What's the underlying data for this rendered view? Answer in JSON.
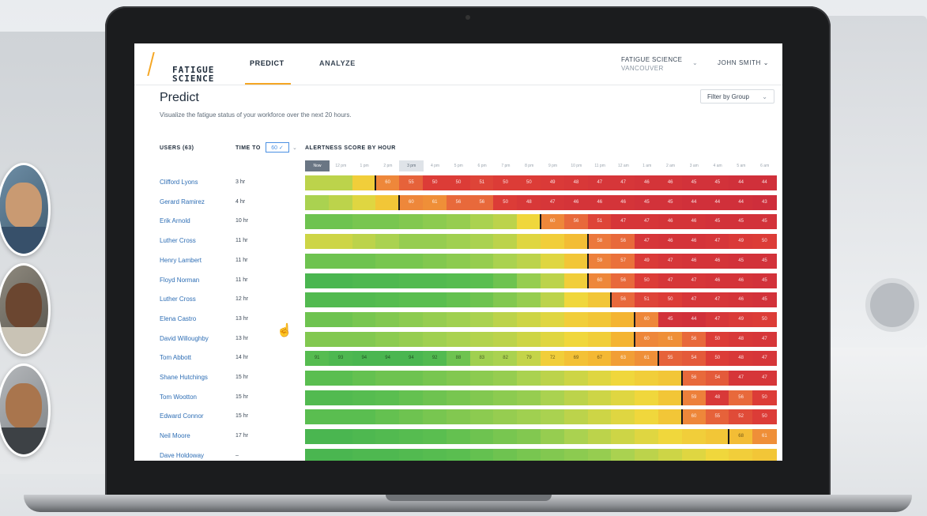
{
  "app": {
    "logo_line1": "FATIGUE",
    "logo_line2": "SCIENCE",
    "nav": {
      "predict": "PREDICT",
      "analyze": "ANALYZE"
    },
    "org": {
      "name": "FATIGUE SCIENCE",
      "city": "VANCOUVER",
      "chevron": "⌄"
    },
    "user": "JOHN SMITH ⌄",
    "accent": "#f5a623",
    "link_color": "#2e6eb5"
  },
  "page": {
    "title": "Predict",
    "subtitle": "Visualize the fatigue status of your workforce over the next 20 hours.",
    "filter_label": "Filter by Group",
    "filter_chevron": "⌄"
  },
  "table": {
    "users_header": "USERS (63)",
    "timeto_header": "TIME TO",
    "timeto_value": "60 ✓",
    "timeto_chevron": "⌄",
    "alertness_header": "ALERTNESS SCORE BY HOUR",
    "hours": [
      "Now",
      "12 pm",
      "1 pm",
      "2 pm",
      "3 pm",
      "4 pm",
      "5 pm",
      "6 pm",
      "7 pm",
      "8 pm",
      "9 pm",
      "10 pm",
      "11 pm",
      "12 am",
      "1 am",
      "2 am",
      "3 am",
      "4 am",
      "5 am",
      "6 am"
    ],
    "selected_hour_index": 4,
    "rows": [
      {
        "name": "Clifford Lyons",
        "time_to": "3 hr",
        "marker_index": 3,
        "scores": [
          80,
          80,
          72,
          60,
          55,
          50,
          50,
          51,
          50,
          50,
          49,
          48,
          47,
          47,
          46,
          46,
          45,
          45,
          44,
          44
        ],
        "labels": [
          "",
          "",
          "",
          "60",
          "55",
          "50",
          "50",
          "51",
          "50",
          "50",
          "49",
          "48",
          "47",
          "47",
          "46",
          "46",
          "45",
          "45",
          "44",
          "44"
        ]
      },
      {
        "name": "Gerard Ramirez",
        "time_to": "4 hr",
        "marker_index": 4,
        "scores": [
          82,
          80,
          76,
          70,
          60,
          61,
          56,
          56,
          50,
          48,
          47,
          46,
          46,
          46,
          45,
          45,
          44,
          44,
          44,
          43
        ],
        "labels": [
          "",
          "",
          "",
          "",
          "60",
          "61",
          "56",
          "56",
          "50",
          "48",
          "47",
          "46",
          "46",
          "46",
          "45",
          "45",
          "44",
          "44",
          "44",
          "43"
        ]
      },
      {
        "name": "Erik Arnold",
        "time_to": "10 hr",
        "marker_index": 10,
        "scores": [
          88,
          88,
          87,
          87,
          86,
          85,
          84,
          82,
          80,
          74,
          60,
          56,
          51,
          47,
          47,
          46,
          46,
          45,
          45,
          45
        ],
        "labels": [
          "",
          "",
          "",
          "",
          "",
          "",
          "",
          "",
          "",
          "",
          "60",
          "56",
          "51",
          "47",
          "47",
          "46",
          "46",
          "45",
          "45",
          "45"
        ]
      },
      {
        "name": "Luther Cross",
        "time_to": "11 hr",
        "marker_index": 12,
        "scores": [
          78,
          78,
          80,
          82,
          84,
          84,
          83,
          82,
          80,
          76,
          72,
          68,
          58,
          56,
          47,
          46,
          46,
          47,
          49,
          50
        ],
        "labels": [
          "",
          "",
          "",
          "",
          "",
          "",
          "",
          "",
          "",
          "",
          "",
          "",
          "58",
          "56",
          "47",
          "46",
          "46",
          "47",
          "49",
          "50"
        ]
      },
      {
        "name": "Henry Lambert",
        "time_to": "11 hr",
        "marker_index": 12,
        "scores": [
          88,
          88,
          88,
          87,
          87,
          86,
          85,
          84,
          82,
          80,
          76,
          70,
          59,
          57,
          49,
          47,
          46,
          46,
          45,
          45
        ],
        "labels": [
          "",
          "",
          "",
          "",
          "",
          "",
          "",
          "",
          "",
          "",
          "",
          "",
          "59",
          "57",
          "49",
          "47",
          "46",
          "46",
          "45",
          "45"
        ]
      },
      {
        "name": "Floyd Norman",
        "time_to": "11 hr",
        "marker_index": 12,
        "scores": [
          94,
          94,
          93,
          93,
          92,
          92,
          91,
          90,
          88,
          84,
          80,
          72,
          60,
          56,
          50,
          47,
          47,
          46,
          46,
          45
        ],
        "labels": [
          "",
          "",
          "",
          "",
          "",
          "",
          "",
          "",
          "",
          "",
          "",
          "",
          "60",
          "56",
          "50",
          "47",
          "47",
          "46",
          "46",
          "45"
        ]
      },
      {
        "name": "Luther Cross",
        "time_to": "12 hr",
        "marker_index": 13,
        "scores": [
          92,
          92,
          92,
          91,
          90,
          90,
          89,
          88,
          86,
          84,
          80,
          74,
          70,
          56,
          51,
          50,
          47,
          47,
          46,
          45
        ],
        "labels": [
          "",
          "",
          "",
          "",
          "",
          "",
          "",
          "",
          "",
          "",
          "",
          "",
          "",
          "56",
          "51",
          "50",
          "47",
          "47",
          "46",
          "45"
        ]
      },
      {
        "name": "Elena Castro",
        "time_to": "13 hr",
        "marker_index": 14,
        "scores": [
          88,
          88,
          87,
          86,
          85,
          84,
          83,
          82,
          80,
          78,
          76,
          72,
          70,
          66,
          60,
          45,
          44,
          47,
          49,
          50
        ],
        "labels": [
          "",
          "",
          "",
          "",
          "",
          "",
          "",
          "",
          "",
          "",
          "",
          "",
          "",
          "",
          "60",
          "45",
          "44",
          "47",
          "49",
          "50"
        ]
      },
      {
        "name": "David Willoughby",
        "time_to": "13 hr",
        "marker_index": 14,
        "scores": [
          86,
          86,
          86,
          85,
          84,
          83,
          82,
          81,
          80,
          78,
          76,
          74,
          72,
          66,
          60,
          61,
          56,
          50,
          48,
          47
        ],
        "labels": [
          "",
          "",
          "",
          "",
          "",
          "",
          "",
          "",
          "",
          "",
          "",
          "",
          "",
          "",
          "60",
          "61",
          "56",
          "50",
          "48",
          "47"
        ]
      },
      {
        "name": "Tom Abbott",
        "time_to": "14 hr",
        "marker_index": 15,
        "scores": [
          91,
          93,
          94,
          94,
          94,
          92,
          88,
          83,
          82,
          79,
          72,
          69,
          67,
          63,
          61,
          55,
          54,
          50,
          48,
          47
        ],
        "labels": [
          "91",
          "93",
          "94",
          "94",
          "94",
          "92",
          "88",
          "83",
          "82",
          "79",
          "72",
          "69",
          "67",
          "63",
          "61",
          "55",
          "54",
          "50",
          "48",
          "47"
        ]
      },
      {
        "name": "Shane Hutchings",
        "time_to": "15 hr",
        "marker_index": 16,
        "scores": [
          90,
          90,
          89,
          88,
          88,
          87,
          86,
          85,
          84,
          82,
          80,
          78,
          76,
          74,
          72,
          70,
          56,
          54,
          47,
          47
        ],
        "labels": [
          "",
          "",
          "",
          "",
          "",
          "",
          "",
          "",
          "",
          "",
          "",
          "",
          "",
          "",
          "",
          "",
          "56",
          "54",
          "47",
          "47"
        ]
      },
      {
        "name": "Tom Wootton",
        "time_to": "15 hr",
        "marker_index": 16,
        "scores": [
          92,
          92,
          91,
          90,
          89,
          88,
          87,
          86,
          85,
          84,
          82,
          80,
          78,
          76,
          74,
          70,
          59,
          48,
          56,
          50
        ],
        "labels": [
          "",
          "",
          "",
          "",
          "",
          "",
          "",
          "",
          "",
          "",
          "",
          "",
          "",
          "",
          "",
          "",
          "59",
          "48",
          "56",
          "50"
        ]
      },
      {
        "name": "Edward Connor",
        "time_to": "15 hr",
        "marker_index": 16,
        "scores": [
          90,
          90,
          90,
          89,
          88,
          87,
          86,
          85,
          84,
          83,
          82,
          80,
          78,
          76,
          74,
          70,
          60,
          55,
          52,
          50
        ],
        "labels": [
          "",
          "",
          "",
          "",
          "",
          "",
          "",
          "",
          "",
          "",
          "",
          "",
          "",
          "",
          "",
          "",
          "60",
          "55",
          "52",
          "50"
        ]
      },
      {
        "name": "Neil Moore",
        "time_to": "17 hr",
        "marker_index": 18,
        "scores": [
          94,
          94,
          93,
          92,
          91,
          90,
          89,
          88,
          87,
          86,
          84,
          82,
          80,
          78,
          76,
          74,
          72,
          70,
          68,
          61
        ],
        "labels": [
          "",
          "",
          "",
          "",
          "",
          "",
          "",
          "",
          "",
          "",
          "",
          "",
          "",
          "",
          "",
          "",
          "",
          "",
          "68",
          "61"
        ]
      },
      {
        "name": "Dave Holdoway",
        "time_to": "–",
        "marker_index": -1,
        "scores": [
          94,
          94,
          93,
          93,
          92,
          91,
          90,
          89,
          88,
          87,
          86,
          85,
          84,
          82,
          80,
          78,
          76,
          74,
          72,
          70
        ],
        "labels": [
          "",
          "",
          "",
          "",
          "",
          "",
          "",
          "",
          "",
          "",
          "",
          "",
          "",
          "",
          "",
          "",
          "",
          "",
          "",
          ""
        ]
      }
    ]
  },
  "icons": {
    "cursor": "hand-pointer-icon",
    "chevron": "chevron-down-icon"
  }
}
